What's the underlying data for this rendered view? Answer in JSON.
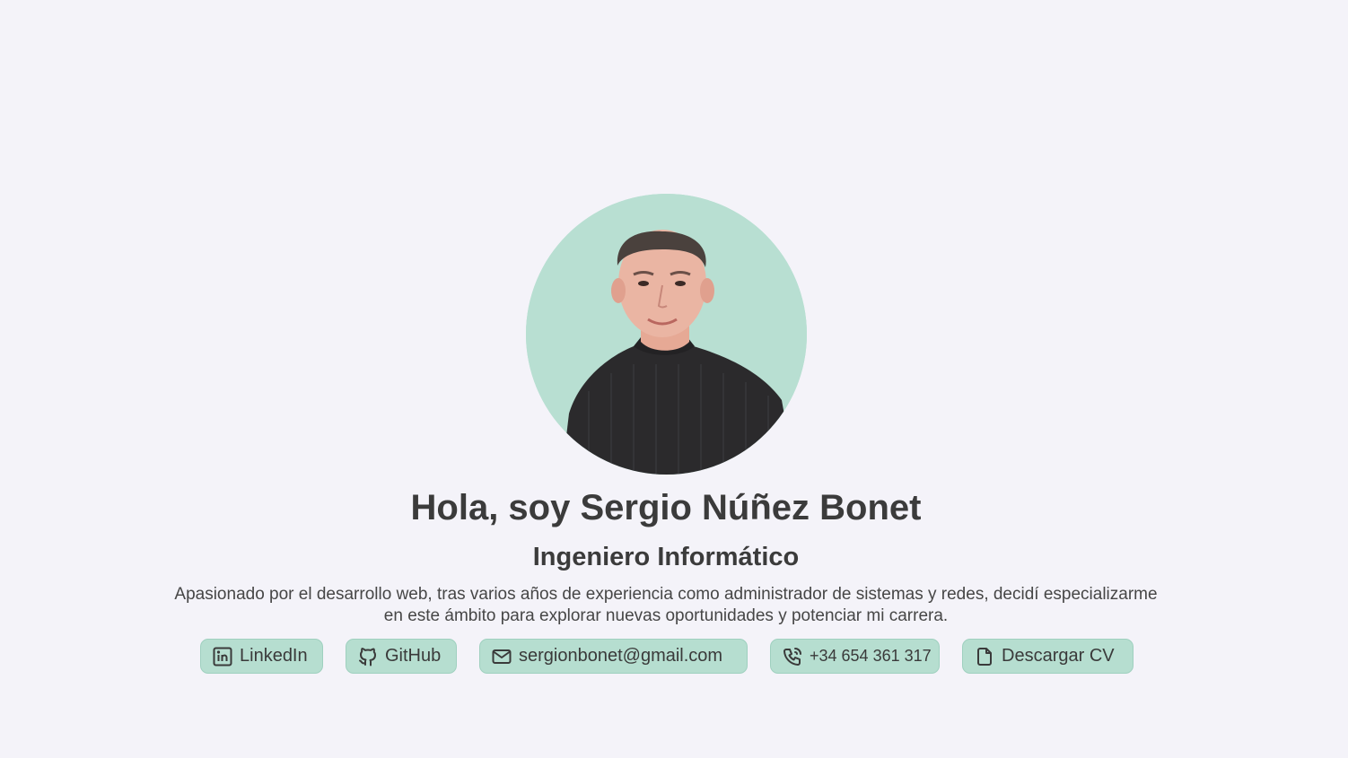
{
  "profile": {
    "avatar_alt": "Sergio Núñez Bonet",
    "heading": "Hola, soy Sergio Núñez Bonet",
    "role": "Ingeniero Informático",
    "bio": "Apasionado por el desarrollo web, tras varios años de experiencia como administrador de sistemas y redes, decidí especializarme en este ámbito para explorar nuevas oportunidades y potenciar mi carrera."
  },
  "links": {
    "linkedin": {
      "label": "LinkedIn",
      "icon": "linkedin-icon"
    },
    "github": {
      "label": "GitHub",
      "icon": "github-icon"
    },
    "email": {
      "label": "sergionbonet@gmail.com",
      "icon": "mail-icon"
    },
    "phone": {
      "label": "+34 654 361 317",
      "icon": "phone-icon"
    },
    "cv": {
      "label": "Descargar CV",
      "icon": "file-icon"
    }
  },
  "colors": {
    "background": "#f4f3f9",
    "accent": "#b6ded0",
    "text": "#3b3b3b"
  }
}
